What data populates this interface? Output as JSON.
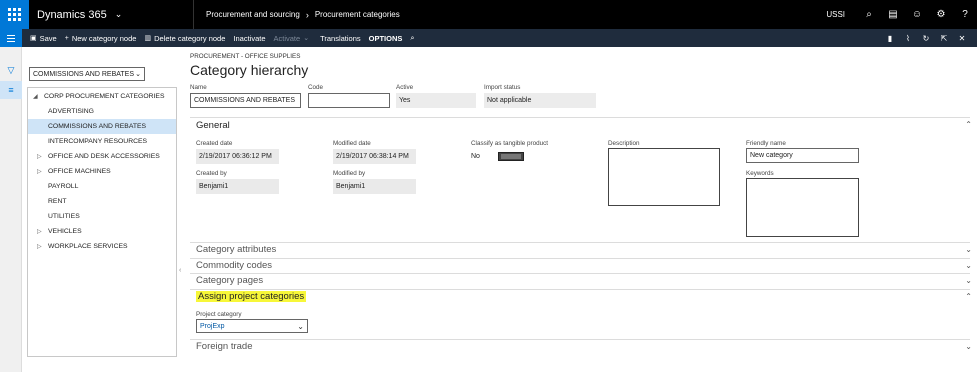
{
  "topbar": {
    "app_name": "Dynamics 365",
    "breadcrumb": [
      "Procurement and sourcing",
      "Procurement categories"
    ],
    "company": "USSI",
    "icons": [
      "search-icon",
      "chat-icon",
      "smiley-icon",
      "gear-icon",
      "help-icon"
    ]
  },
  "actions": {
    "save": "Save",
    "new_category_node": "New category node",
    "delete_category_node": "Delete category node",
    "inactivate": "Inactivate",
    "activate": "Activate",
    "translations": "Translations",
    "options": "OPTIONS"
  },
  "tree": {
    "selector": "COMMISSIONS AND REBATES",
    "root": "CORP PROCUREMENT CATEGORIES",
    "items": [
      {
        "label": "ADVERTISING",
        "expandable": false,
        "selected": false
      },
      {
        "label": "COMMISSIONS AND REBATES",
        "expandable": false,
        "selected": true
      },
      {
        "label": "INTERCOMPANY RESOURCES",
        "expandable": false,
        "selected": false
      },
      {
        "label": "OFFICE AND DESK ACCESSORIES",
        "expandable": true,
        "selected": false
      },
      {
        "label": "OFFICE MACHINES",
        "expandable": true,
        "selected": false
      },
      {
        "label": "PAYROLL",
        "expandable": false,
        "selected": false
      },
      {
        "label": "RENT",
        "expandable": false,
        "selected": false
      },
      {
        "label": "UTILITIES",
        "expandable": false,
        "selected": false
      },
      {
        "label": "VEHICLES",
        "expandable": true,
        "selected": false
      },
      {
        "label": "WORKPLACE SERVICES",
        "expandable": true,
        "selected": false
      }
    ]
  },
  "header": {
    "context": "PROCUREMENT - OFFICE SUPPLIES",
    "title": "Category hierarchy",
    "name_label": "Name",
    "name_value": "COMMISSIONS AND REBATES",
    "code_label": "Code",
    "code_value": "",
    "active_label": "Active",
    "active_value": "Yes",
    "import_status_label": "Import status",
    "import_status_value": "Not applicable"
  },
  "general": {
    "title": "General",
    "created_date_label": "Created date",
    "created_date_value": "2/19/2017 06:36:12 PM",
    "modified_date_label": "Modified date",
    "modified_date_value": "2/19/2017 06:38:14 PM",
    "classify_label": "Classify as tangible product",
    "classify_value": "No",
    "description_label": "Description",
    "friendly_name_label": "Friendly name",
    "friendly_name_value": "New category",
    "created_by_label": "Created by",
    "created_by_value": "Benjami1",
    "modified_by_label": "Modified by",
    "modified_by_value": "Benjami1",
    "keywords_label": "Keywords"
  },
  "sections": {
    "category_attributes": "Category attributes",
    "commodity_codes": "Commodity codes",
    "category_pages": "Category pages",
    "assign_project_categories": "Assign project categories",
    "project_category_label": "Project category",
    "project_category_value": "ProjExp",
    "foreign_trade": "Foreign trade"
  },
  "colors": {
    "nav_bg": "#000000",
    "action_bg": "#1f2c3d",
    "accent": "#0078d7",
    "selection": "#cfe4f7",
    "highlight": "#f7f739"
  }
}
